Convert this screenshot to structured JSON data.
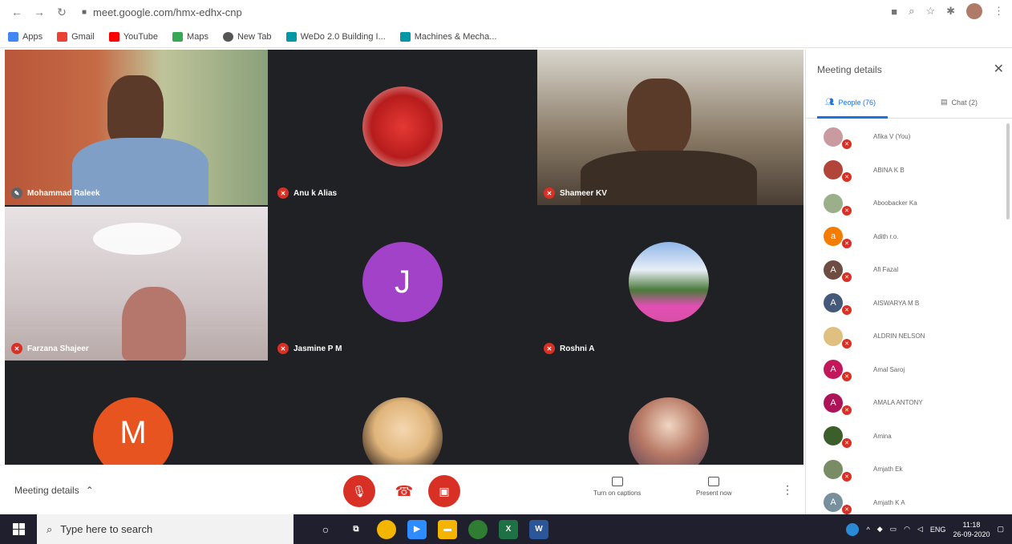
{
  "browser": {
    "url": "meet.google.com/hmx-edhx-cnp",
    "bookmarks": [
      {
        "label": "Apps",
        "color": "#4285f4"
      },
      {
        "label": "Gmail",
        "color": "#ea4335"
      },
      {
        "label": "YouTube",
        "color": "#ff0000"
      },
      {
        "label": "Maps",
        "color": "#34a853"
      },
      {
        "label": "New Tab",
        "color": "#555555"
      },
      {
        "label": "WeDo 2.0 Building I...",
        "color": "#0097a7"
      },
      {
        "label": "Machines & Mecha...",
        "color": "#0097a7"
      }
    ]
  },
  "tiles": [
    {
      "name": "Mohammad Raleek",
      "kind": "video",
      "bg": "#8a6a4e"
    },
    {
      "name": "Anu k Alias",
      "kind": "image-avatar",
      "bg": "#202124",
      "avatar_color": "#c62828"
    },
    {
      "name": "Shameer KV",
      "kind": "video",
      "bg": "#6b5a46"
    },
    {
      "name": "Farzana Shajeer",
      "kind": "video",
      "bg": "#cfc4c4"
    },
    {
      "name": "Jasmine P M",
      "kind": "letter-avatar",
      "bg": "#202124",
      "letter": "J",
      "avatar_color": "#a142c9"
    },
    {
      "name": "Roshni A",
      "kind": "image-avatar",
      "bg": "#202124",
      "avatar_color": "#d94fa8"
    },
    {
      "name": "",
      "kind": "letter-avatar",
      "bg": "#202124",
      "letter": "M",
      "avatar_color": "#e8541f"
    },
    {
      "name": "",
      "kind": "image-avatar",
      "bg": "#202124",
      "avatar_color": "#e0b47a"
    },
    {
      "name": "",
      "kind": "image-avatar",
      "bg": "#202124",
      "avatar_color": "#b87a66"
    }
  ],
  "panel": {
    "title": "Meeting details",
    "tab_people": "People (76)",
    "tab_chat": "Chat (2)",
    "people": [
      {
        "name": "Afika V (You)",
        "letter": "",
        "color": "#c99ba0"
      },
      {
        "name": "ABINA K B",
        "letter": "",
        "color": "#b2453a"
      },
      {
        "name": "Aboobacker Ka",
        "letter": "",
        "color": "#9bb08a"
      },
      {
        "name": "Adith r.o.",
        "letter": "a",
        "color": "#f57c00"
      },
      {
        "name": "Afi Fazal",
        "letter": "A",
        "color": "#6d4c41"
      },
      {
        "name": "AISWARYA M B",
        "letter": "A",
        "color": "#455a7a"
      },
      {
        "name": "ALDRIN NELSON",
        "letter": "",
        "color": "#e0c080"
      },
      {
        "name": "Amal Saroj",
        "letter": "A",
        "color": "#c2185b"
      },
      {
        "name": "AMALA ANTONY",
        "letter": "A",
        "color": "#ad1457"
      },
      {
        "name": "Amina",
        "letter": "",
        "color": "#3b5e2b"
      },
      {
        "name": "Amjath Ek",
        "letter": "",
        "color": "#7a8c66"
      },
      {
        "name": "Amjath K A",
        "letter": "A",
        "color": "#78909c"
      }
    ]
  },
  "meetbar": {
    "details_label": "Meeting details",
    "captions_label": "Turn on captions",
    "present_label": "Present now"
  },
  "taskbar": {
    "search_placeholder": "Type here to search",
    "lang": "ENG",
    "time": "11:18",
    "date": "26-09-2020"
  }
}
